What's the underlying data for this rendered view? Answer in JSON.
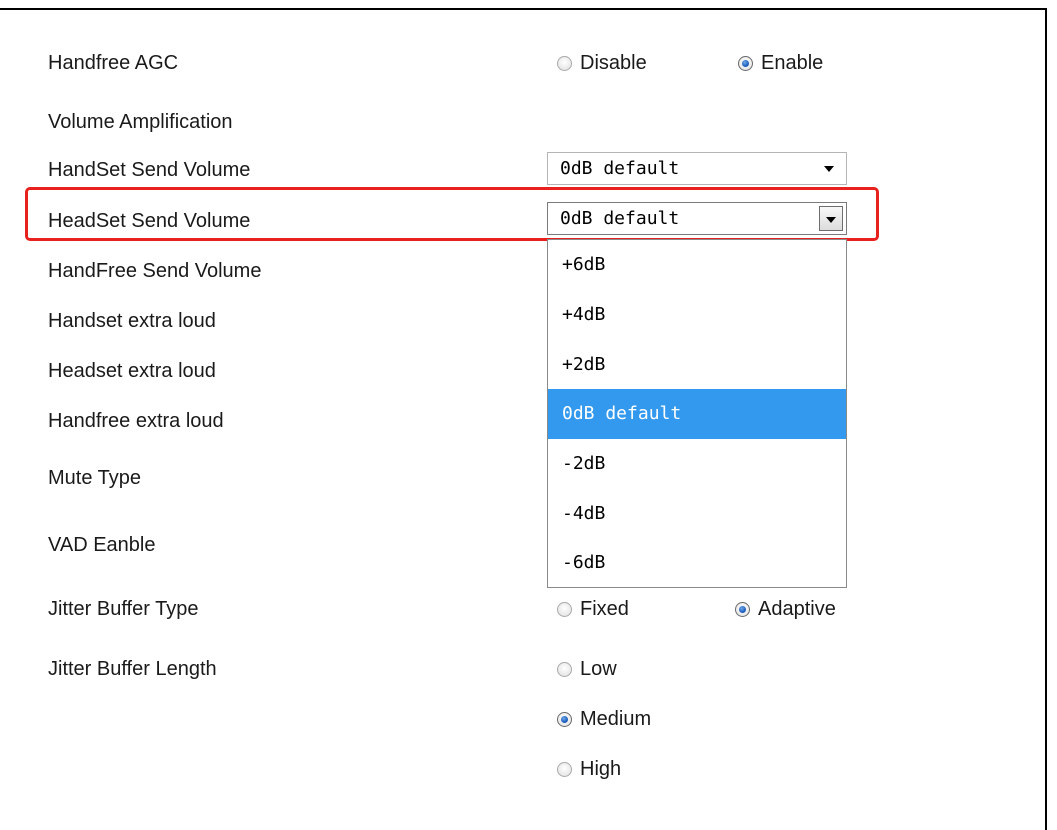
{
  "rows": {
    "handfree_agc": "Handfree AGC",
    "volume_amplification": "Volume Amplification",
    "handset_send_volume": "HandSet Send Volume",
    "headset_send_volume": "HeadSet Send Volume",
    "handfree_send_volume": "HandFree Send Volume",
    "handset_extra_loud": "Handset extra loud",
    "headset_extra_loud": "Headset extra loud",
    "handfree_extra_loud": "Handfree extra loud",
    "mute_type": "Mute Type",
    "vad_enable": "VAD Eanble",
    "jitter_buffer_type": "Jitter Buffer Type",
    "jitter_buffer_length": "Jitter Buffer Length"
  },
  "agc": {
    "disable": "Disable",
    "enable": "Enable",
    "selected": "Enable"
  },
  "handset_send_select": {
    "value": "0dB default"
  },
  "headset_send_select": {
    "value": "0dB default",
    "options": [
      "+6dB",
      "+4dB",
      "+2dB",
      "0dB default",
      "-2dB",
      "-4dB",
      "-6dB"
    ],
    "highlighted": "0dB default"
  },
  "jitter_type": {
    "fixed": "Fixed",
    "adaptive": "Adaptive",
    "selected": "Adaptive"
  },
  "jitter_length": {
    "low": "Low",
    "medium": "Medium",
    "high": "High",
    "selected": "Medium"
  },
  "colors": {
    "highlight_border": "#e8211f",
    "option_selected_bg": "#3399ee",
    "radio_dot": "#1f5fbf"
  }
}
